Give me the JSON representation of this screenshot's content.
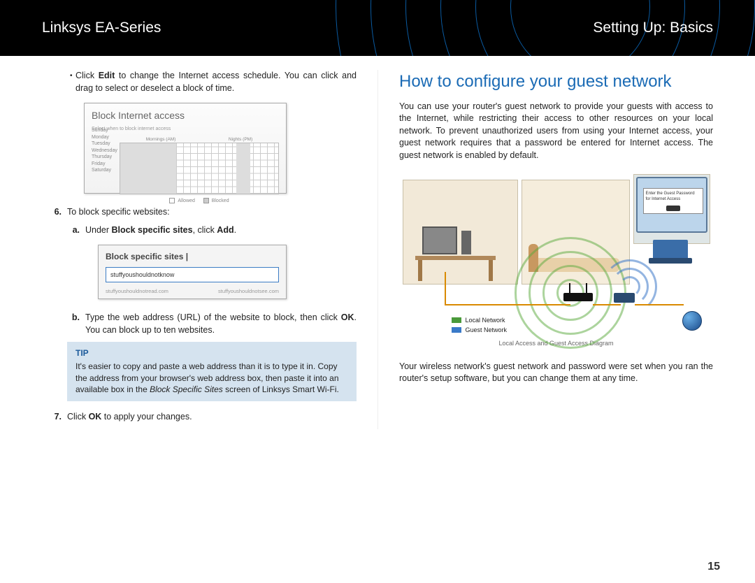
{
  "header": {
    "left": "Linksys EA-Series",
    "right": "Setting Up: Basics"
  },
  "left": {
    "bullet_pre": "Click ",
    "bullet_bold": "Edit",
    "bullet_post": " to change the Internet access schedule. You can click and drag to select or deselect a block of time.",
    "ss1_title": "Block Internet access",
    "ss1_sub": "Select when to block internet access",
    "ss1_hdr1": "Mornings (AM)",
    "ss1_hdr2": "Nights (PM)",
    "ss1_days": "Sunday\nMonday\nTuesday\nWednesday\nThursday\nFriday\nSaturday",
    "ss1_allowed": "Allowed",
    "ss1_blocked": "Blocked",
    "step6": "To block specific websites:",
    "step6a_pre": "Under ",
    "step6a_b1": "Block specific sites",
    "step6a_mid": ", click ",
    "step6a_b2": "Add",
    "step6a_post": ".",
    "ss2_title": "Block specific sites  |",
    "ss2_input": "stuffyoushouldnotknow",
    "ss2_url1": "stuffyoushouldnotread.com",
    "ss2_url2": "stuffyoushouldnotsee.com",
    "step6b_pre": "Type the web address (URL) of the website to block, then click ",
    "step6b_b": "OK",
    "step6b_post": ". You can block up to ten websites.",
    "tip_label": "TIP",
    "tip_text": "It's easier to copy and paste a web address than it is to type it in. Copy the address from your browser's web address box, then paste it into an available box in the ",
    "tip_i": "Block Specific Sites",
    "tip_text2": " screen of Linksys Smart Wi-Fi.",
    "step7_pre": "Click ",
    "step7_b": "OK",
    "step7_post": " to apply your changes."
  },
  "right": {
    "heading": "How to configure your guest network",
    "intro": "You can use your router's guest network to provide your guests with access to the Internet, while restricting their access to other resources on your local network. To prevent unauthorized users from using your Internet access, your guest network requires that a password be entered for Internet access. The guest network is enabled by default.",
    "dialog_text": "Enter the Guest Password for Internet Access",
    "legend1": "Local Network",
    "legend2": "Guest Network",
    "caption": "Local Access and Guest Access Diagram",
    "para2": "Your wireless network's guest network and password were set when you ran the router's setup software, but you can change them at any time."
  },
  "page_number": "15"
}
